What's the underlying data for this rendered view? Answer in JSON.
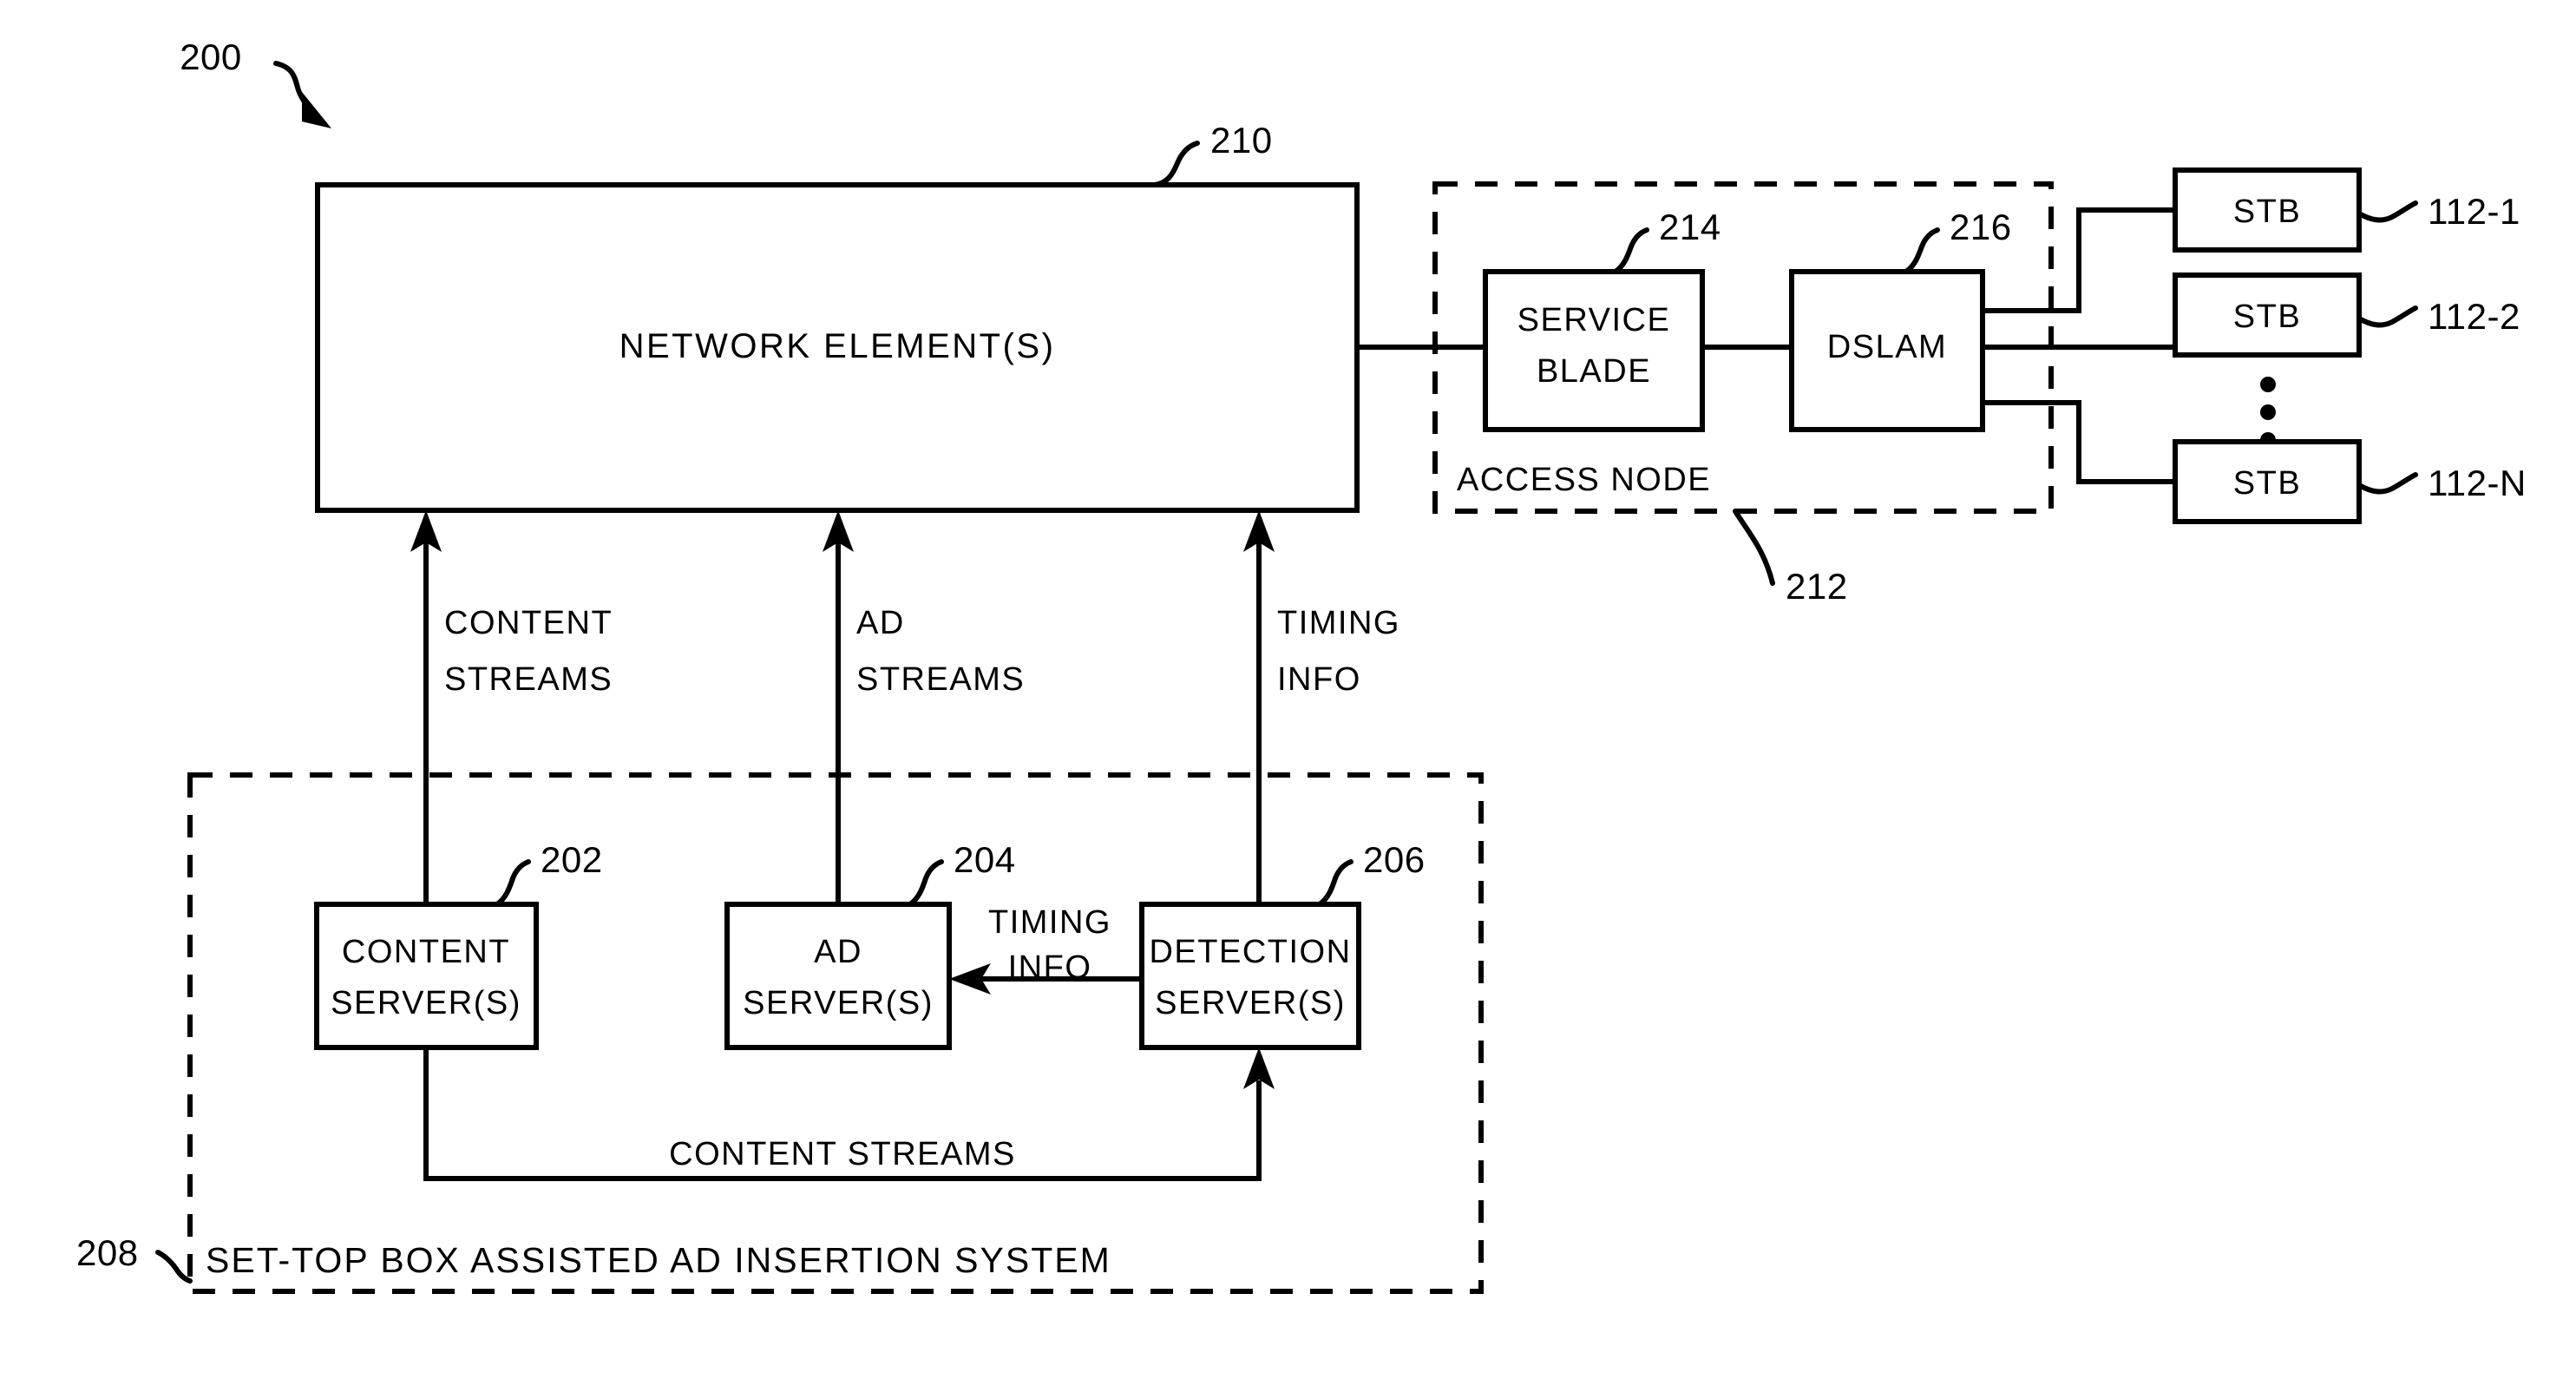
{
  "figure": {
    "ref_main": "200",
    "type": "block-diagram",
    "title_implied": "SET-TOP BOX ASSISTED AD INSERTION SYSTEM"
  },
  "blocks": {
    "network_element": {
      "label": "NETWORK ELEMENT(S)",
      "ref": "210"
    },
    "service_blade": {
      "label_line1": "SERVICE",
      "label_line2": "BLADE",
      "ref": "214"
    },
    "dslam": {
      "label": "DSLAM",
      "ref": "216"
    },
    "access_node": {
      "label": "ACCESS NODE",
      "ref": "212"
    },
    "content_server": {
      "label_line1": "CONTENT",
      "label_line2": "SERVER(S)",
      "ref": "202"
    },
    "ad_server": {
      "label_line1": "AD",
      "label_line2": "SERVER(S)",
      "ref": "204"
    },
    "detection_server": {
      "label_line1": "DETECTION",
      "label_line2": "SERVER(S)",
      "ref": "206"
    },
    "ad_insertion_system": {
      "label": "SET-TOP BOX ASSISTED AD INSERTION SYSTEM",
      "ref": "208"
    }
  },
  "stbs": [
    {
      "label": "STB",
      "ref": "112-1"
    },
    {
      "label": "STB",
      "ref": "112-2"
    },
    {
      "label": "STB",
      "ref": "112-N"
    }
  ],
  "stb_ellipsis": "⋮",
  "flows": {
    "content_streams_up": {
      "line1": "CONTENT",
      "line2": "STREAMS"
    },
    "ad_streams_up": {
      "line1": "AD",
      "line2": "STREAMS"
    },
    "timing_info_up": {
      "line1": "TIMING",
      "line2": "INFO"
    },
    "timing_info_side": {
      "line1": "TIMING",
      "line2": "INFO"
    },
    "content_streams_bottom": {
      "label": "CONTENT STREAMS"
    }
  },
  "colors": {
    "ink": "#000000",
    "paper": "#ffffff"
  }
}
